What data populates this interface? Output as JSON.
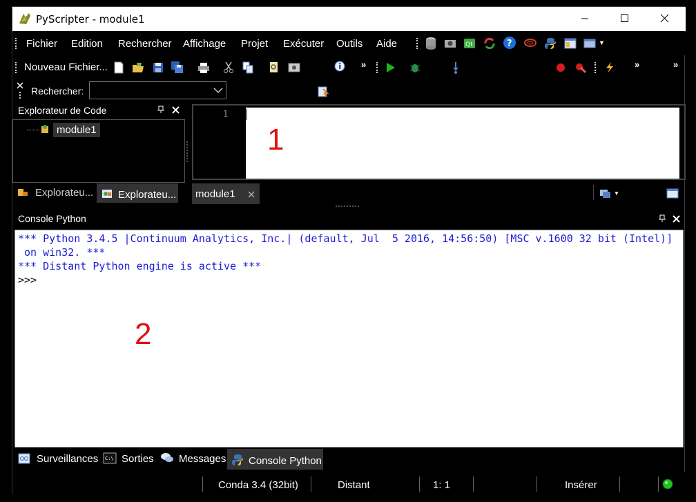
{
  "window": {
    "title": "PyScripter - module1"
  },
  "menu": {
    "items": [
      "Fichier",
      "Edition",
      "Rechercher",
      "Affichage",
      "Projet",
      "Exécuter",
      "Outils",
      "Aide"
    ]
  },
  "toolbar": {
    "new_file_label": "Nouveau Fichier..."
  },
  "search": {
    "label": "Rechercher:",
    "value": ""
  },
  "code_explorer": {
    "title": "Explorateur de Code",
    "tree_item": "module1",
    "tab1": "Explorateu...",
    "tab2": "Explorateu..."
  },
  "editor": {
    "line_number": "1",
    "tab_label": "module1",
    "annotation": "1"
  },
  "console": {
    "title": "Console Python",
    "line1": "*** Python 3.4.5 |Continuum Analytics, Inc.| (default, Jul  5 2016, 14:56:50) [MSC v.1600 32 bit (Intel)]",
    "line2": " on win32. ***",
    "line3": "*** Distant Python engine is active ***",
    "prompt": ">>>",
    "annotation": "2"
  },
  "bottom_tabs": [
    "Surveillances",
    "Sorties",
    "Messages",
    "Console Python"
  ],
  "status": {
    "interpreter": "Conda 3.4 (32bit)",
    "engine": "Distant",
    "position": "1:  1",
    "mode": "Insérer"
  },
  "colors": {
    "console_text": "#1c1cd6",
    "annotation": "#e01010",
    "status_ok": "#22c022"
  }
}
